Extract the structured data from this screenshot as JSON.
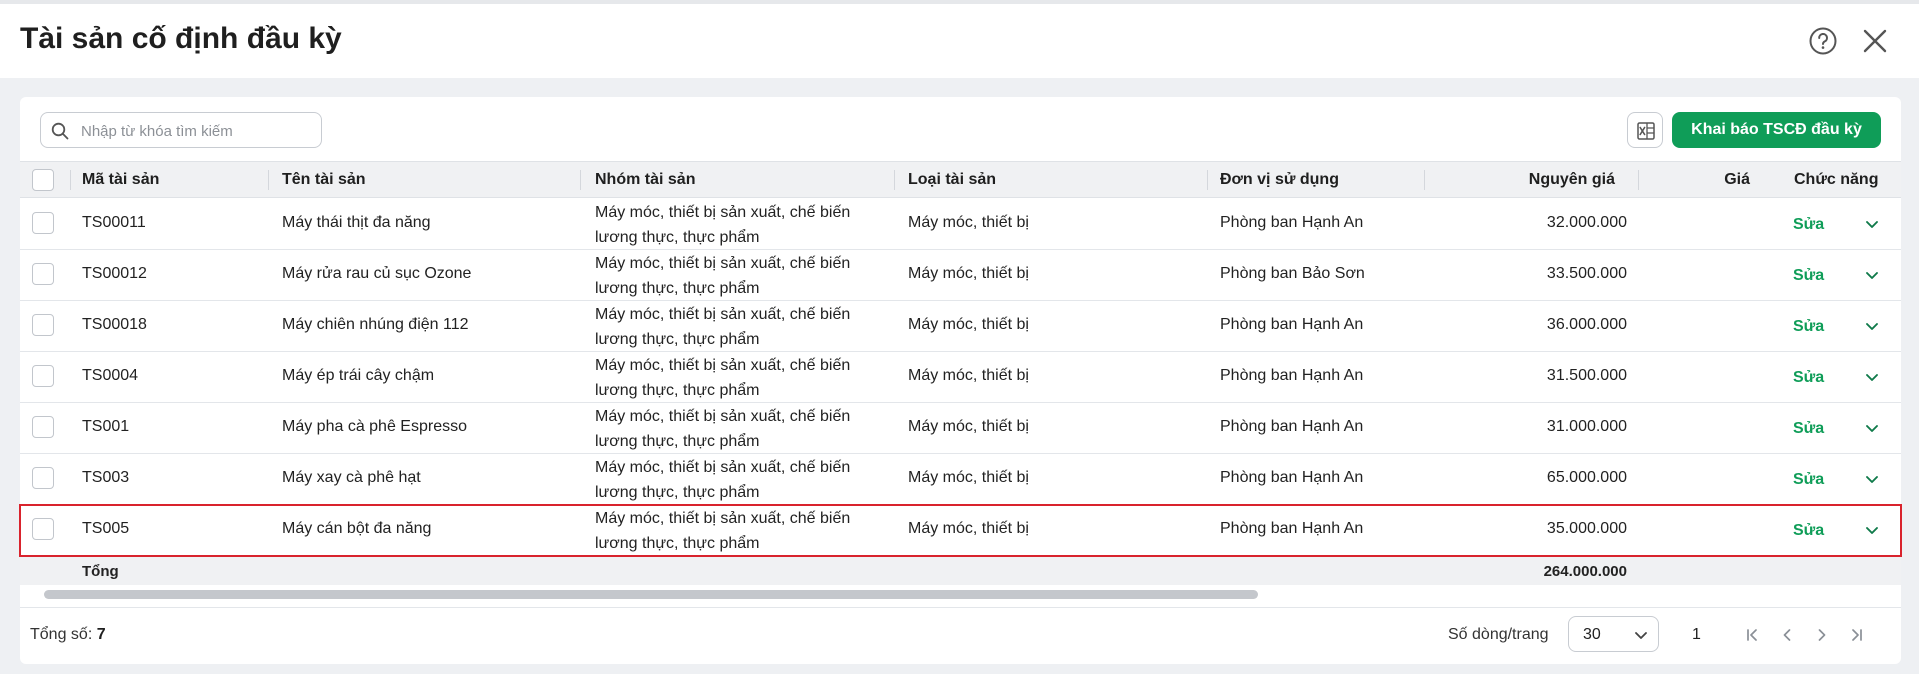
{
  "header": {
    "title": "Tài sản cố định đầu kỳ"
  },
  "toolbar": {
    "search_placeholder": "Nhập từ khóa tìm kiếm",
    "primary_label": "Khai báo TSCĐ đầu kỳ"
  },
  "table": {
    "columns": {
      "code": "Mã tài sản",
      "name": "Tên tài sản",
      "group": "Nhóm tài sản",
      "type": "Loại tài sản",
      "unit": "Đơn vị sử dụng",
      "price": "Nguyên giá",
      "value": "Giá",
      "actions": "Chức năng"
    },
    "rows": [
      {
        "code": "TS00011",
        "name": "Máy thái thịt đa năng",
        "group_line1": "Máy móc, thiết bị sản xuất, chế biến",
        "group_line2": "lương thực, thực phẩm",
        "type": "Máy móc, thiết bị",
        "unit": "Phòng ban Hạnh An",
        "price": "32.000.000",
        "action": "Sửa"
      },
      {
        "code": "TS00012",
        "name": "Máy rửa rau củ sục Ozone",
        "group_line1": "Máy móc, thiết bị sản xuất, chế biến",
        "group_line2": "lương thực, thực phẩm",
        "type": "Máy móc, thiết bị",
        "unit": "Phòng ban Bảo Sơn",
        "price": "33.500.000",
        "action": "Sửa"
      },
      {
        "code": "TS00018",
        "name": "Máy chiên nhúng điện 112",
        "group_line1": "Máy móc, thiết bị sản xuất, chế biến",
        "group_line2": "lương thực, thực phẩm",
        "type": "Máy móc, thiết bị",
        "unit": "Phòng ban Hạnh An",
        "price": "36.000.000",
        "action": "Sửa"
      },
      {
        "code": "TS0004",
        "name": "Máy ép trái cây chậm",
        "group_line1": "Máy móc, thiết bị sản xuất, chế biến",
        "group_line2": "lương thực, thực phẩm",
        "type": "Máy móc, thiết bị",
        "unit": "Phòng ban Hạnh An",
        "price": "31.500.000",
        "action": "Sửa"
      },
      {
        "code": "TS001",
        "name": "Máy pha cà phê Espresso",
        "group_line1": "Máy móc, thiết bị sản xuất, chế biến",
        "group_line2": "lương thực, thực phẩm",
        "type": "Máy móc, thiết bị",
        "unit": "Phòng ban Hạnh An",
        "price": "31.000.000",
        "action": "Sửa"
      },
      {
        "code": "TS003",
        "name": "Máy xay cà phê hạt",
        "group_line1": "Máy móc, thiết bị sản xuất, chế biến",
        "group_line2": "lương thực, thực phẩm",
        "type": "Máy móc, thiết bị",
        "unit": "Phòng ban Hạnh An",
        "price": "65.000.000",
        "action": "Sửa"
      },
      {
        "code": "TS005",
        "name": "Máy cán bột đa năng",
        "group_line1": "Máy móc, thiết bị sản xuất, chế biến",
        "group_line2": "lương thực, thực phẩm",
        "type": "Máy móc, thiết bị",
        "unit": "Phòng ban Hạnh An",
        "price": "35.000.000",
        "action": "Sửa"
      }
    ],
    "total_label": "Tổng",
    "total_price": "264.000.000"
  },
  "footer": {
    "total_prefix": "Tổng số:",
    "total_count": "7",
    "rows_per_page_label": "Số dòng/trang",
    "rows_per_page": "30",
    "current_page": "1"
  },
  "colors": {
    "primary": "#0f9d58",
    "selection_outline": "#d9232d"
  }
}
